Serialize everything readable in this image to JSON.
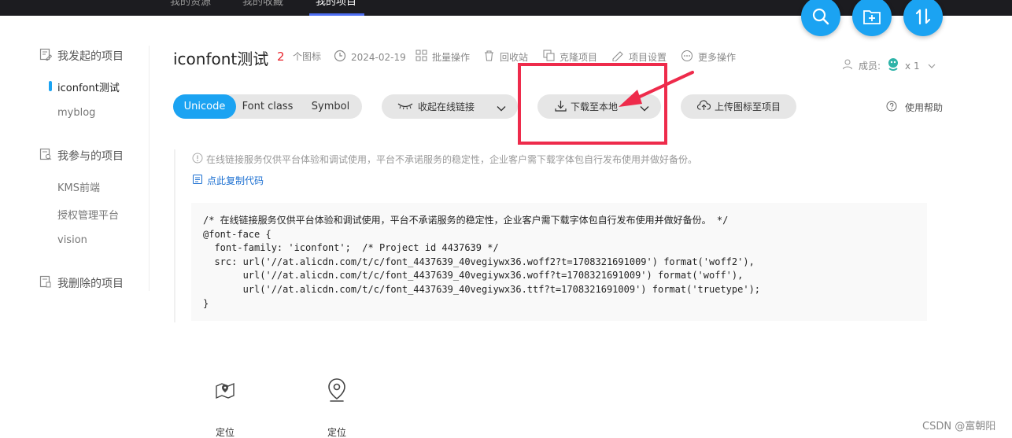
{
  "topnav": {
    "items": [
      {
        "label": "我的资源",
        "active": false
      },
      {
        "label": "我的收藏",
        "active": false
      },
      {
        "label": "我的项目",
        "active": true
      }
    ]
  },
  "fabs": {
    "search": "search-icon",
    "add_folder": "add-folder-icon",
    "sort": "sort-icon"
  },
  "sidebar": {
    "groups": [
      {
        "label": "我发起的项目",
        "items": [
          "iconfont测试",
          "myblog"
        ]
      },
      {
        "label": "我参与的项目",
        "items": [
          "KMS前端",
          "授权管理平台",
          "vision"
        ]
      },
      {
        "label": "我删除的项目",
        "items": []
      }
    ],
    "active_item": "iconfont测试"
  },
  "project": {
    "title": "iconfont测试",
    "icon_count": "2",
    "icon_count_unit": "个图标",
    "date": "2024-02-19",
    "actions": [
      "批量操作",
      "回收站",
      "克隆项目",
      "项目设置",
      "更多操作"
    ],
    "members_label": "成员:",
    "members_count": "x 1"
  },
  "toolbar": {
    "modes": [
      "Unicode",
      "Font class",
      "Symbol"
    ],
    "active_mode": "Unicode",
    "collapse_link": "收起在线链接",
    "download": "下载至本地",
    "upload": "上传图标至项目",
    "help": "使用帮助"
  },
  "notice": {
    "text": "在线链接服务仅供平台体验和调试使用，平台不承诺服务的稳定性，企业客户需下载字体包自行发布使用并做好备份。",
    "copy": "点此复制代码"
  },
  "code": {
    "lines": [
      "/* 在线链接服务仅供平台体验和调试使用，平台不承诺服务的稳定性，企业客户需下载字体包自行发布使用并做好备份。 */",
      "@font-face {",
      "  font-family: 'iconfont';  /* Project id 4437639 */",
      "  src: url('//at.alicdn.com/t/c/font_4437639_40vegiywx36.woff2?t=1708321691009') format('woff2'),",
      "       url('//at.alicdn.com/t/c/font_4437639_40vegiywx36.woff?t=1708321691009') format('woff'),",
      "       url('//at.alicdn.com/t/c/font_4437639_40vegiywx36.ttf?t=1708321691009') format('truetype');",
      "}"
    ]
  },
  "icons": [
    {
      "name": "map-pin-icon",
      "label": "定位"
    },
    {
      "name": "location-icon",
      "label": "定位"
    }
  ],
  "annotation": {
    "color": "#ee2b4b"
  },
  "accent": "#1ba3f2",
  "watermark": "CSDN @富朝阳"
}
